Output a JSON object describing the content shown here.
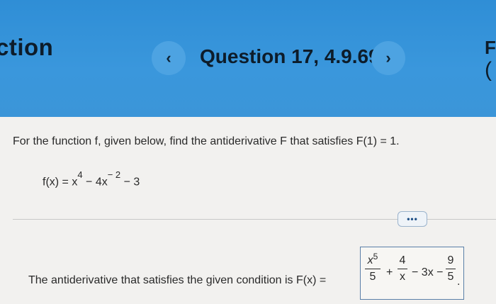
{
  "header": {
    "section_label": "ction",
    "question_title": "Question 17, 4.9.69",
    "prev_glyph": "‹",
    "next_glyph": "›",
    "edge_char_top": "F",
    "edge_char_bottom": "("
  },
  "problem": {
    "prompt": "For the function f, given below, find the antiderivative F that satisfies F(1) = 1.",
    "func_prefix": "f(x) = x",
    "func_exp1": "4",
    "func_mid": " − 4x",
    "func_exp2": "− 2",
    "func_suffix": " − 3"
  },
  "more_button": {
    "label": "•••"
  },
  "answer": {
    "text": "The antiderivative that satisfies the given condition is F(x) =",
    "term1_num_base": "x",
    "term1_num_exp": "5",
    "term1_den": "5",
    "op1": "+",
    "term2_num": "4",
    "term2_den": "x",
    "middle": "− 3x −",
    "term3_num": "9",
    "term3_den": "5",
    "trailing": "."
  },
  "colors": {
    "header_blue": "#3a97dc",
    "nav_button": "#4da3e2",
    "answer_border": "#5a7fa8"
  }
}
